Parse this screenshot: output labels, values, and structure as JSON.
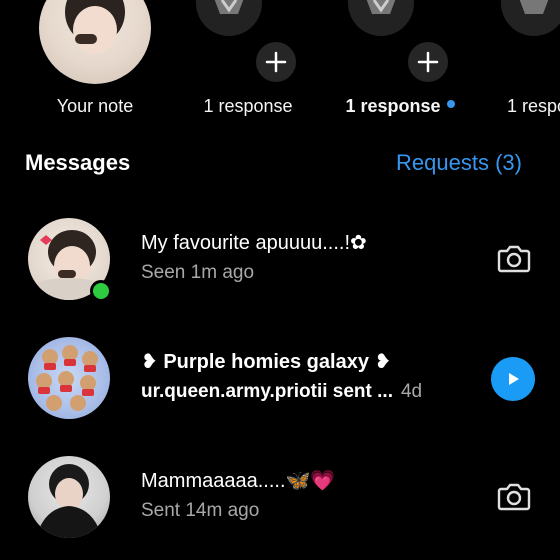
{
  "notes": [
    {
      "caption": "Your note",
      "bold": false
    },
    {
      "caption": "1 response",
      "bold": false
    },
    {
      "caption": "1 response",
      "bold": true,
      "unread_dot": true
    },
    {
      "caption": "1 respo",
      "bold": false
    }
  ],
  "messages_header": {
    "title": "Messages",
    "requests": "Requests (3)"
  },
  "threads": [
    {
      "name": "My favourite apuuuu....!✿",
      "sub": "Seen 1m ago",
      "online": true,
      "action_icon": "camera-icon"
    },
    {
      "name": "❥ Purple homies galaxy ❥",
      "sub": "ur.queen.army.priotii sent ...",
      "time": "4d",
      "unread": true,
      "action_icon": "play-icon"
    },
    {
      "name": "Mammaaaaa.....🦋💗",
      "sub": "Sent 14m ago",
      "online": false,
      "action_icon": "camera-icon"
    }
  ],
  "colors": {
    "background": "#000000",
    "accent_blue": "#3797f0",
    "online_green": "#2ecc40",
    "secondary_text": "#a8a8a8"
  }
}
